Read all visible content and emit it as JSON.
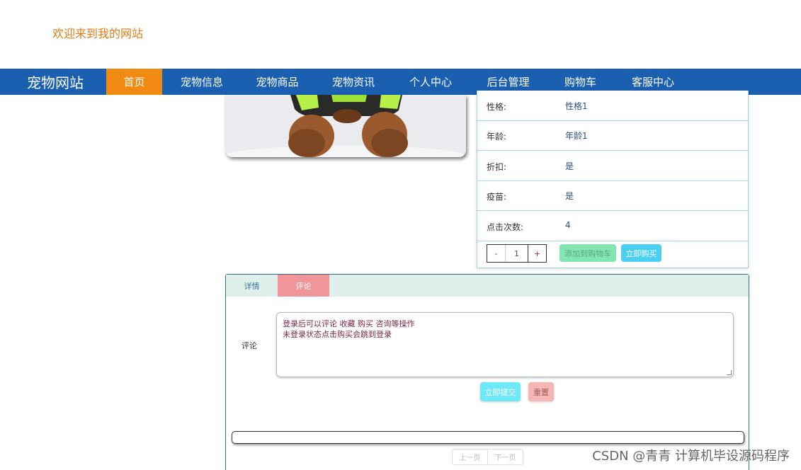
{
  "header": {
    "welcome_text": "欢迎来到我的网站"
  },
  "navbar": {
    "brand": "宠物网站",
    "items": [
      {
        "label": "首页",
        "active": true
      },
      {
        "label": "宠物信息"
      },
      {
        "label": "宠物商品"
      },
      {
        "label": "宠物资讯"
      },
      {
        "label": "个人中心"
      },
      {
        "label": "后台管理"
      },
      {
        "label": "购物车"
      },
      {
        "label": "客服中心"
      }
    ]
  },
  "details": {
    "rows": [
      {
        "label": "性格:",
        "value": "性格1"
      },
      {
        "label": "年龄:",
        "value": "年龄1"
      },
      {
        "label": "折扣:",
        "value": "是"
      },
      {
        "label": "疫苗:",
        "value": "是"
      },
      {
        "label": "点击次数:",
        "value": "4"
      }
    ],
    "stepper": {
      "minus": "-",
      "value": "1",
      "plus": "+"
    },
    "add_to_cart": "添加到购物车",
    "buy_now": "立即购买"
  },
  "tabs": [
    {
      "label": "详情"
    },
    {
      "label": "评论",
      "active": true
    }
  ],
  "comment": {
    "label": "评论",
    "text_line_1": "登录后可以评论 收藏 购买 咨询等操作",
    "text_line_2": "未登录状态点击购买会跳到登录",
    "submit": "立即提交",
    "reset": "重置"
  },
  "pager": {
    "prev": "上一页",
    "next": "下一页"
  },
  "watermark": "CSDN @青青  计算机毕设源码程序",
  "colors": {
    "nav_bg": "#1a5fb0",
    "nav_active": "#f08a12",
    "welcome": "#e07b14",
    "tab_active": "#f0959a"
  }
}
